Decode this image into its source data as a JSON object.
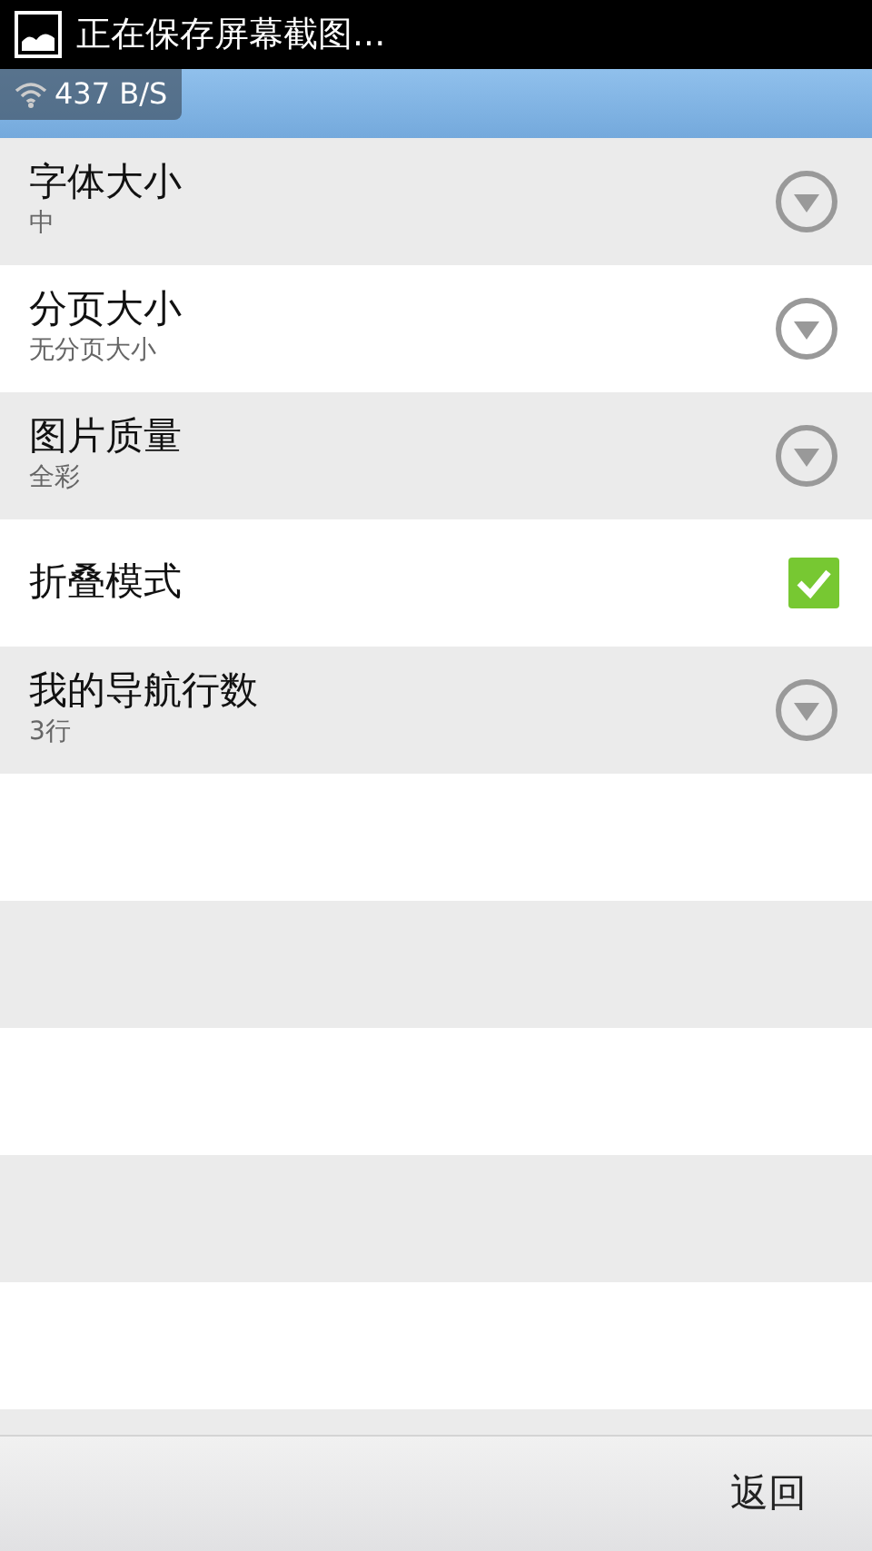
{
  "notification": {
    "text": "正在保存屏幕截图..."
  },
  "speed_overlay": {
    "text": "437 B/S"
  },
  "settings": [
    {
      "kind": "list",
      "title": "字体大小",
      "value": "中"
    },
    {
      "kind": "list",
      "title": "分页大小",
      "value": "无分页大小"
    },
    {
      "kind": "list",
      "title": "图片质量",
      "value": "全彩"
    },
    {
      "kind": "checkbox",
      "title": "折叠模式",
      "checked": true
    },
    {
      "kind": "list",
      "title": "我的导航行数",
      "value": "3行"
    }
  ],
  "footer": {
    "back_button": "返回"
  }
}
